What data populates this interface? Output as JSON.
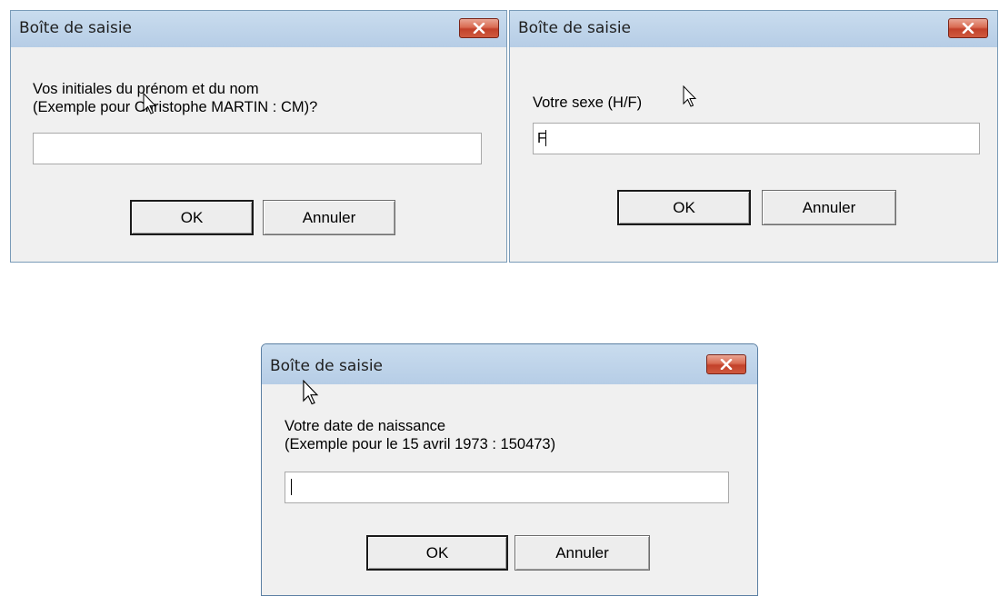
{
  "dialogs": [
    {
      "title": "Boîte de saisie",
      "prompt": "Vos initiales du prénom et du nom\n(Exemple pour Christophe MARTIN : CM)?",
      "value": "",
      "ok_label": "OK",
      "cancel_label": "Annuler"
    },
    {
      "title": "Boîte de saisie",
      "prompt": "Votre sexe (H/F)",
      "value": "F",
      "ok_label": "OK",
      "cancel_label": "Annuler"
    },
    {
      "title": "Boîte de saisie",
      "prompt": "Votre date de naissance\n(Exemple pour le 15 avril 1973 : 150473)",
      "value": "",
      "ok_label": "OK",
      "cancel_label": "Annuler"
    }
  ],
  "icons": {
    "close": "close-icon",
    "pointer": "mouse-pointer-icon"
  },
  "colors": {
    "close_button": "#c2412a",
    "titlebar": "#bcd2ea",
    "dialog_bg": "#f0f0f0"
  }
}
